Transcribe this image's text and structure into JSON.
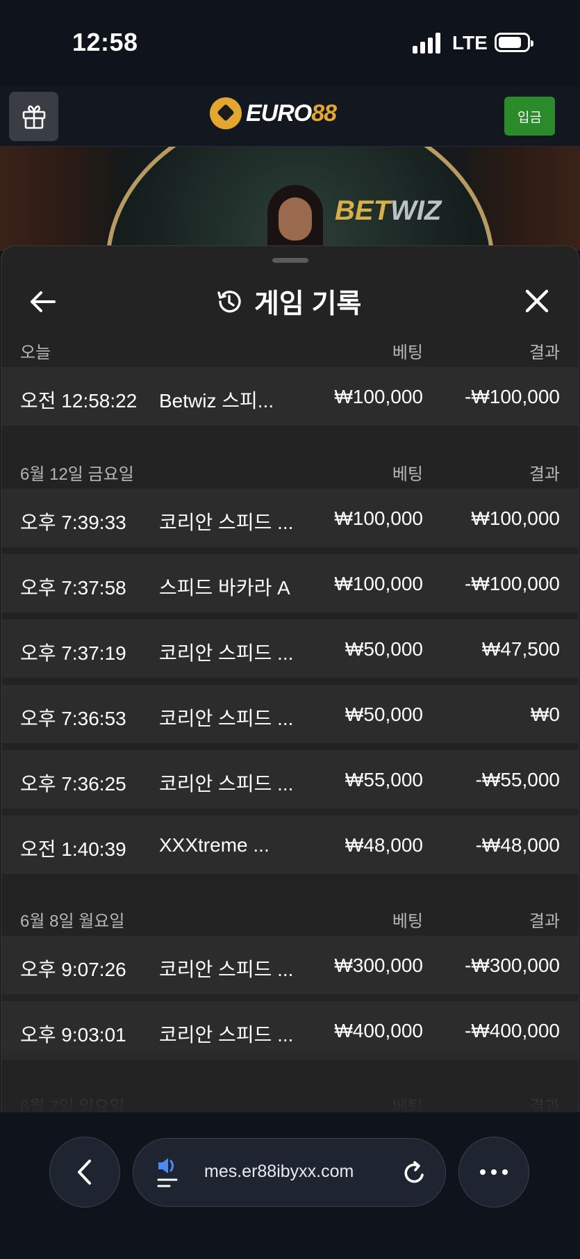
{
  "status_bar": {
    "time": "12:58",
    "network": "LTE"
  },
  "header": {
    "logo_euro": "EURO",
    "logo_num": "88",
    "deposit_label": "입금"
  },
  "banner": {
    "brand_bet": "BET",
    "brand_wiz": "WIZ"
  },
  "history": {
    "title": "게임 기록",
    "sections": [
      {
        "date": "오늘",
        "bet_header": "베팅",
        "result_header": "결과",
        "rows": [
          {
            "time": "오전 12:58:22",
            "game": "Betwiz 스피...",
            "bet": "₩100,000",
            "result": "-₩100,000"
          }
        ]
      },
      {
        "date": "6월 12일 금요일",
        "bet_header": "베팅",
        "result_header": "결과",
        "rows": [
          {
            "time": "오후 7:39:33",
            "game": "코리안 스피드 ...",
            "bet": "₩100,000",
            "result": "₩100,000"
          },
          {
            "time": "오후 7:37:58",
            "game": "스피드 바카라 A",
            "bet": "₩100,000",
            "result": "-₩100,000"
          },
          {
            "time": "오후 7:37:19",
            "game": "코리안 스피드 ...",
            "bet": "₩50,000",
            "result": "₩47,500"
          },
          {
            "time": "오후 7:36:53",
            "game": "코리안 스피드 ...",
            "bet": "₩50,000",
            "result": "₩0"
          },
          {
            "time": "오후 7:36:25",
            "game": "코리안 스피드 ...",
            "bet": "₩55,000",
            "result": "-₩55,000"
          },
          {
            "time": "오전 1:40:39",
            "game": "XXXtreme ...",
            "bet": "₩48,000",
            "result": "-₩48,000"
          }
        ]
      },
      {
        "date": "6월 8일 월요일",
        "bet_header": "베팅",
        "result_header": "결과",
        "rows": [
          {
            "time": "오후 9:07:26",
            "game": "코리안 스피드 ...",
            "bet": "₩300,000",
            "result": "-₩300,000"
          },
          {
            "time": "오후 9:03:01",
            "game": "코리안 스피드 ...",
            "bet": "₩400,000",
            "result": "-₩400,000"
          }
        ]
      },
      {
        "date": "6월 7일 일요일",
        "bet_header": "베팅",
        "result_header": "결과",
        "rows": []
      }
    ]
  },
  "browser": {
    "url": "mes.er88ibyxx.com"
  },
  "colors": {
    "deposit_green": "#2b8a2a",
    "logo_gold": "#e3a72f",
    "sheet_bg": "#232323",
    "row_bg": "#2c2c2c"
  }
}
